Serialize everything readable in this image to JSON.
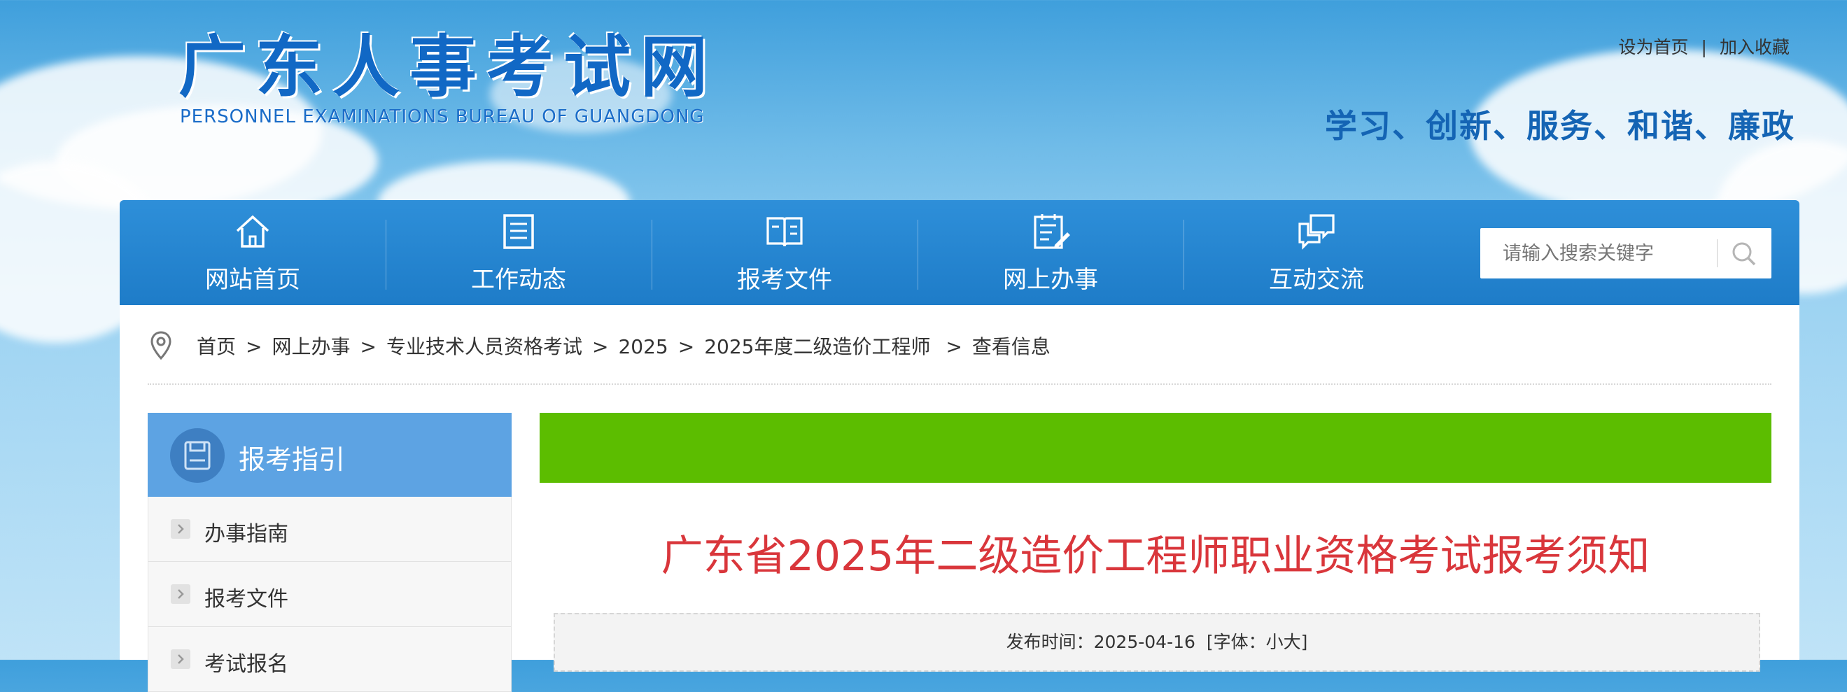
{
  "header": {
    "site_title": "广东人事考试网",
    "site_subtitle": "PERSONNEL EXAMINATIONS BUREAU OF GUANGDONG",
    "top_links": {
      "set_home": "设为首页",
      "separator": "|",
      "add_favorite": "加入收藏"
    },
    "slogan": "学习、创新、服务、和谐、廉政"
  },
  "nav": {
    "items": [
      {
        "label": "网站首页",
        "icon": "home-icon"
      },
      {
        "label": "工作动态",
        "icon": "news-icon"
      },
      {
        "label": "报考文件",
        "icon": "book-icon"
      },
      {
        "label": "网上办事",
        "icon": "clipboard-edit-icon"
      },
      {
        "label": "互动交流",
        "icon": "chat-bubbles-icon"
      }
    ],
    "search": {
      "placeholder": "请输入搜索关键字",
      "icon": "search-icon"
    }
  },
  "breadcrumb": {
    "icon": "location-pin-icon",
    "items": [
      "首页",
      "网上办事",
      "专业技术人员资格考试",
      "2025",
      "2025年度二级造价工程师",
      "查看信息"
    ],
    "separator": ">"
  },
  "sidebar": {
    "title": "报考指引",
    "title_icon": "disk-icon",
    "items": [
      {
        "label": "办事指南"
      },
      {
        "label": "报考文件"
      },
      {
        "label": "考试报名"
      }
    ]
  },
  "article": {
    "title": "广东省2025年二级造价工程师职业资格考试报考须知",
    "meta": {
      "publish_label": "发布时间：",
      "publish_date": "2025-04-16",
      "font_label_open": "[字体：",
      "font_small": "小",
      "font_large": "大",
      "font_label_close": "]"
    }
  },
  "colors": {
    "nav_bg": "#1e7cc8",
    "sidebar_head": "#5da3e3",
    "banner_green": "#5cbd00",
    "title_red": "#d9363b",
    "logo_blue": "#1168c5"
  }
}
